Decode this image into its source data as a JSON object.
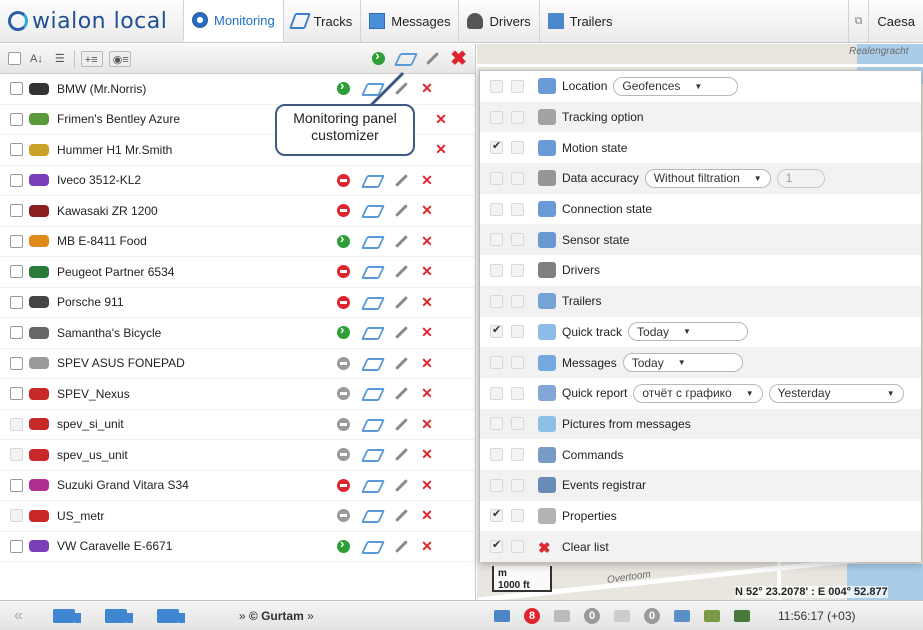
{
  "topbar": {
    "logo": "wialon local",
    "tabs": [
      {
        "label": "Monitoring",
        "icon": "globe-icon"
      },
      {
        "label": "Tracks",
        "icon": "tracks-icon"
      },
      {
        "label": "Messages",
        "icon": "messages-icon"
      },
      {
        "label": "Drivers",
        "icon": "driver-icon"
      },
      {
        "label": "Trailers",
        "icon": "trailer-icon"
      }
    ],
    "user_partial": "Caesa"
  },
  "units": [
    {
      "name": "BMW (Mr.Norris)",
      "status": "green",
      "color": "#333333"
    },
    {
      "name": "Frimen's Bentley Azure",
      "status": "hidden",
      "color": "#5a9a3a"
    },
    {
      "name": "Hummer H1 Mr.Smith",
      "status": "hidden",
      "color": "#c9a227"
    },
    {
      "name": "Iveco 3512-KL2",
      "status": "red",
      "color": "#7a3fb8"
    },
    {
      "name": "Kawasaki ZR 1200",
      "status": "red",
      "color": "#8a2020"
    },
    {
      "name": "MB E-8411 Food",
      "status": "green",
      "color": "#e08a1a"
    },
    {
      "name": "Peugeot Partner 6534",
      "status": "red",
      "color": "#2a7a3a"
    },
    {
      "name": "Porsche 911",
      "status": "red",
      "color": "#444444"
    },
    {
      "name": "Samantha's Bicycle",
      "status": "green",
      "color": "#666666"
    },
    {
      "name": "SPEV ASUS FONEPAD",
      "status": "gray",
      "color": "#999999"
    },
    {
      "name": "SPEV_Nexus",
      "status": "gray",
      "color": "#c82828"
    },
    {
      "name": "spev_si_unit",
      "status": "gray",
      "color": "#c82828",
      "dim": true
    },
    {
      "name": "spev_us_unit",
      "status": "gray",
      "color": "#c82828",
      "dim": true
    },
    {
      "name": "Suzuki Grand Vitara S34",
      "status": "red",
      "color": "#b03090"
    },
    {
      "name": "US_metr",
      "status": "gray",
      "color": "#c82828",
      "dim": true
    },
    {
      "name": "VW Caravelle E-6671",
      "status": "green",
      "color": "#7a3fb8"
    }
  ],
  "callout": {
    "text": "Monitoring panel customizer"
  },
  "customizer": [
    {
      "label": "Location",
      "checked": false,
      "icon": "location-icon",
      "select": "Geofences"
    },
    {
      "label": "Tracking option",
      "checked": false,
      "icon": "tracking-icon"
    },
    {
      "label": "Motion state",
      "checked": true,
      "icon": "motion-icon"
    },
    {
      "label": "Data accuracy",
      "checked": false,
      "icon": "satellite-icon",
      "select": "Without filtration",
      "number": "1"
    },
    {
      "label": "Connection state",
      "checked": false,
      "icon": "connection-icon"
    },
    {
      "label": "Sensor state",
      "checked": false,
      "icon": "sensor-icon"
    },
    {
      "label": "Drivers",
      "checked": false,
      "icon": "drivers-icon"
    },
    {
      "label": "Trailers",
      "checked": false,
      "icon": "trailers-icon"
    },
    {
      "label": "Quick track",
      "checked": true,
      "icon": "quick-track-icon",
      "select": "Today"
    },
    {
      "label": "Messages",
      "checked": false,
      "icon": "messages-icon",
      "select": "Today"
    },
    {
      "label": "Quick report",
      "checked": false,
      "icon": "report-icon",
      "select": "отчёт с графико",
      "select2": "Yesterday"
    },
    {
      "label": "Pictures from messages",
      "checked": false,
      "icon": "pictures-icon"
    },
    {
      "label": "Commands",
      "checked": false,
      "icon": "commands-icon"
    },
    {
      "label": "Events registrar",
      "checked": false,
      "icon": "events-icon"
    },
    {
      "label": "Properties",
      "checked": true,
      "icon": "wrench-icon"
    },
    {
      "label": "Clear list",
      "checked": true,
      "icon": "clear-icon"
    }
  ],
  "map": {
    "label_top": "Realengracht",
    "scale_m": "m",
    "scale_ft": "1000 ft",
    "coords": "N 52° 23.2078' : E 004° 52.877",
    "label_bottom": "Overtoom"
  },
  "bottombar": {
    "brand": "© Gurtam",
    "badge_red": "8",
    "badge_gray1": "0",
    "badge_gray2": "0",
    "clock": "11:56:17 (+03)"
  }
}
